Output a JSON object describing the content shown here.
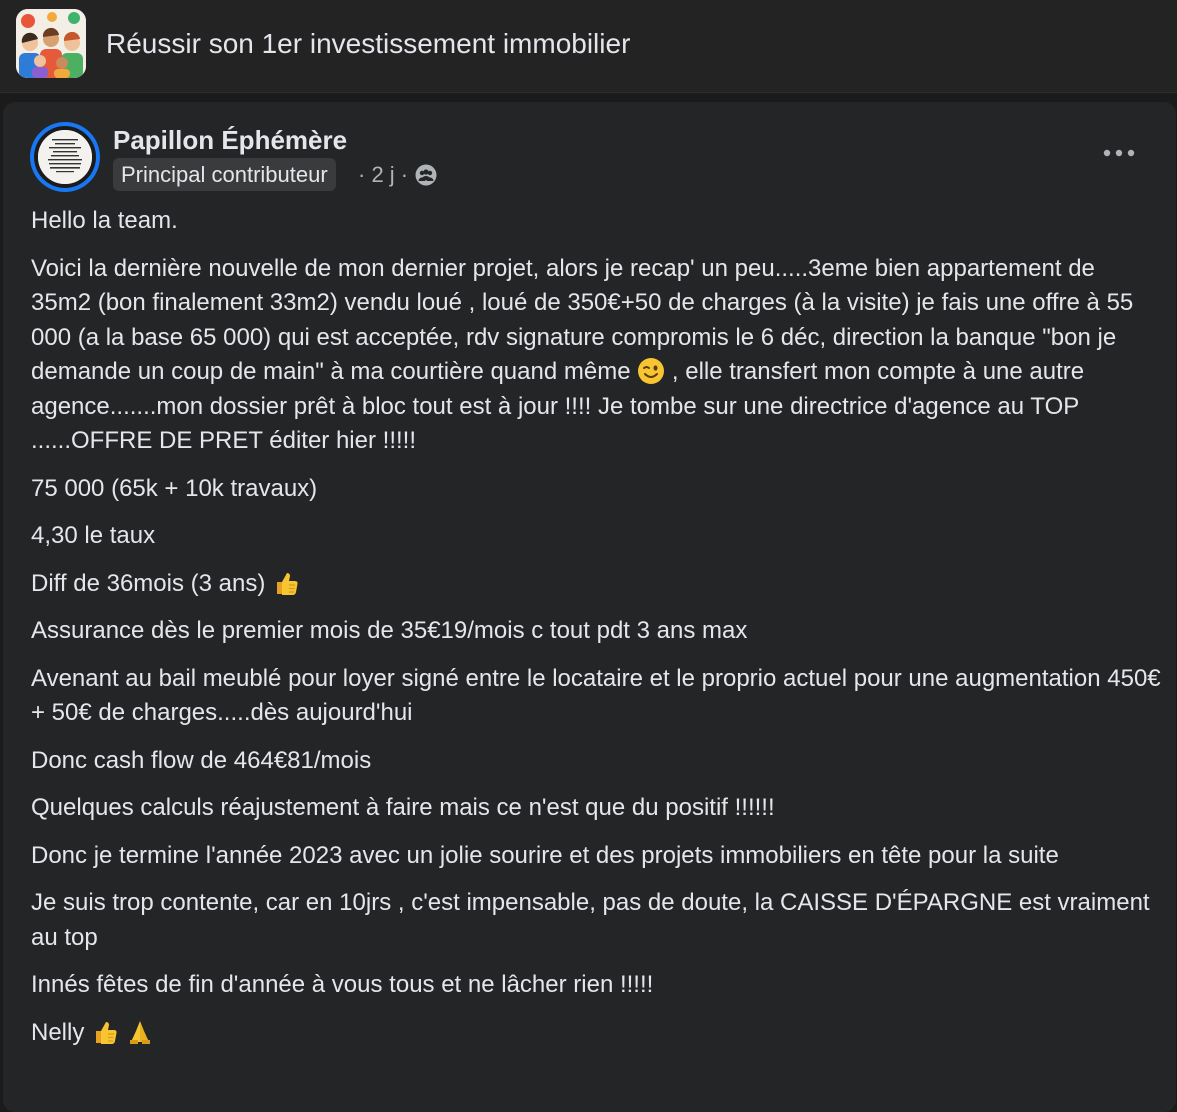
{
  "group": {
    "title": "Réussir son 1er investissement immobilier",
    "avatar_icon": "group-people-illustration"
  },
  "post": {
    "author": {
      "name": "Papillon Éphémère",
      "badge": "Principal contributeur",
      "time": "· 2 j ·",
      "audience_icon": "group-audience-icon"
    },
    "more_icon": "more-options-icon",
    "paragraphs": {
      "p1": "Hello la team.",
      "p2a": "Voici la dernière nouvelle de mon dernier projet, alors je recap' un peu.....3eme bien appartement de 35m2 (bon finalement 33m2) vendu loué , loué de 350€+50 de charges (à la visite) je fais une offre à 55 000 (a la base 65 000) qui est acceptée, rdv signature compromis le 6 déc, direction la banque \"bon je demande un coup de main\" à ma courtière quand même",
      "p2b": " , elle transfert mon compte à une autre agence.......mon dossier prêt à bloc tout est à jour !!!! Je tombe sur une directrice d'agence au TOP ......OFFRE DE PRET éditer hier !!!!!",
      "p3": "75 000 (65k + 10k travaux)",
      "p4": "4,30 le taux",
      "p5": "Diff de 36mois (3 ans)",
      "p6": "Assurance dès le premier mois de 35€19/mois c tout pdt 3 ans max",
      "p7": "Avenant au bail meublé pour  loyer signé entre le locataire et le proprio actuel pour une augmentation 450€+ 50€ de charges.....dès aujourd'hui",
      "p8": "Donc cash flow de 464€81/mois",
      "p9": "Quelques calculs réajustement à faire mais ce n'est que du positif !!!!!!",
      "p10": "Donc je termine l'année 2023 avec un jolie sourire et des projets immobiliers en tête pour la suite",
      "p11": "Je suis trop contente,  car en 10jrs , c'est impensable, pas de doute, la CAISSE D'ÉPARGNE est vraiment au top",
      "p12": "Innés fêtes de fin d'année à vous tous et ne lâcher rien !!!!!",
      "p13": "Nelly"
    },
    "emojis": [
      "winking-face-emoji",
      "thumbs-up-emoji",
      "folded-hands-emoji"
    ]
  }
}
